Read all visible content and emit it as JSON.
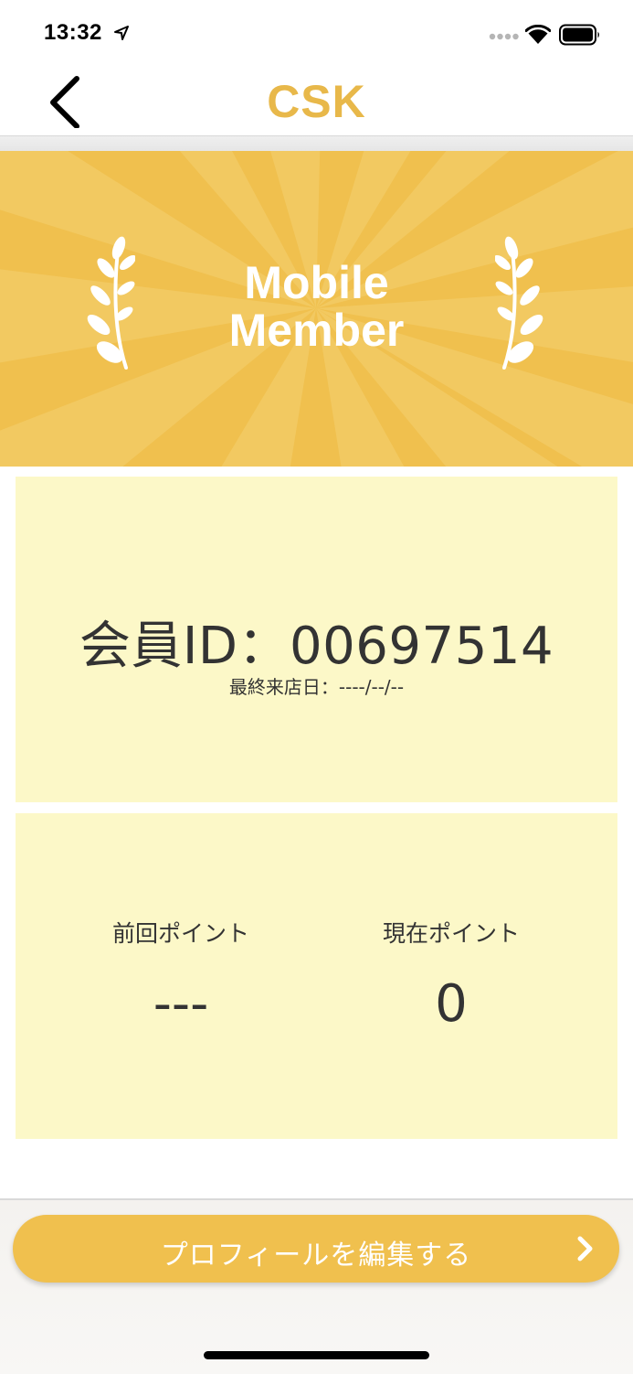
{
  "status_bar": {
    "time": "13:32"
  },
  "nav": {
    "logo": "CSK"
  },
  "banner": {
    "line1": "Mobile",
    "line2": "Member"
  },
  "member": {
    "id_text": "会員ID：00697514",
    "last_visit_text": "最終来店日：----/--/--"
  },
  "points": {
    "previous_label": "前回ポイント",
    "previous_value": "---",
    "current_label": "現在ポイント",
    "current_value": "0"
  },
  "edit_button": {
    "label": "プロフィールを編集する"
  },
  "colors": {
    "accent": "#f0c04e",
    "card": "#fcf8c8",
    "logo": "#e8b84a"
  }
}
